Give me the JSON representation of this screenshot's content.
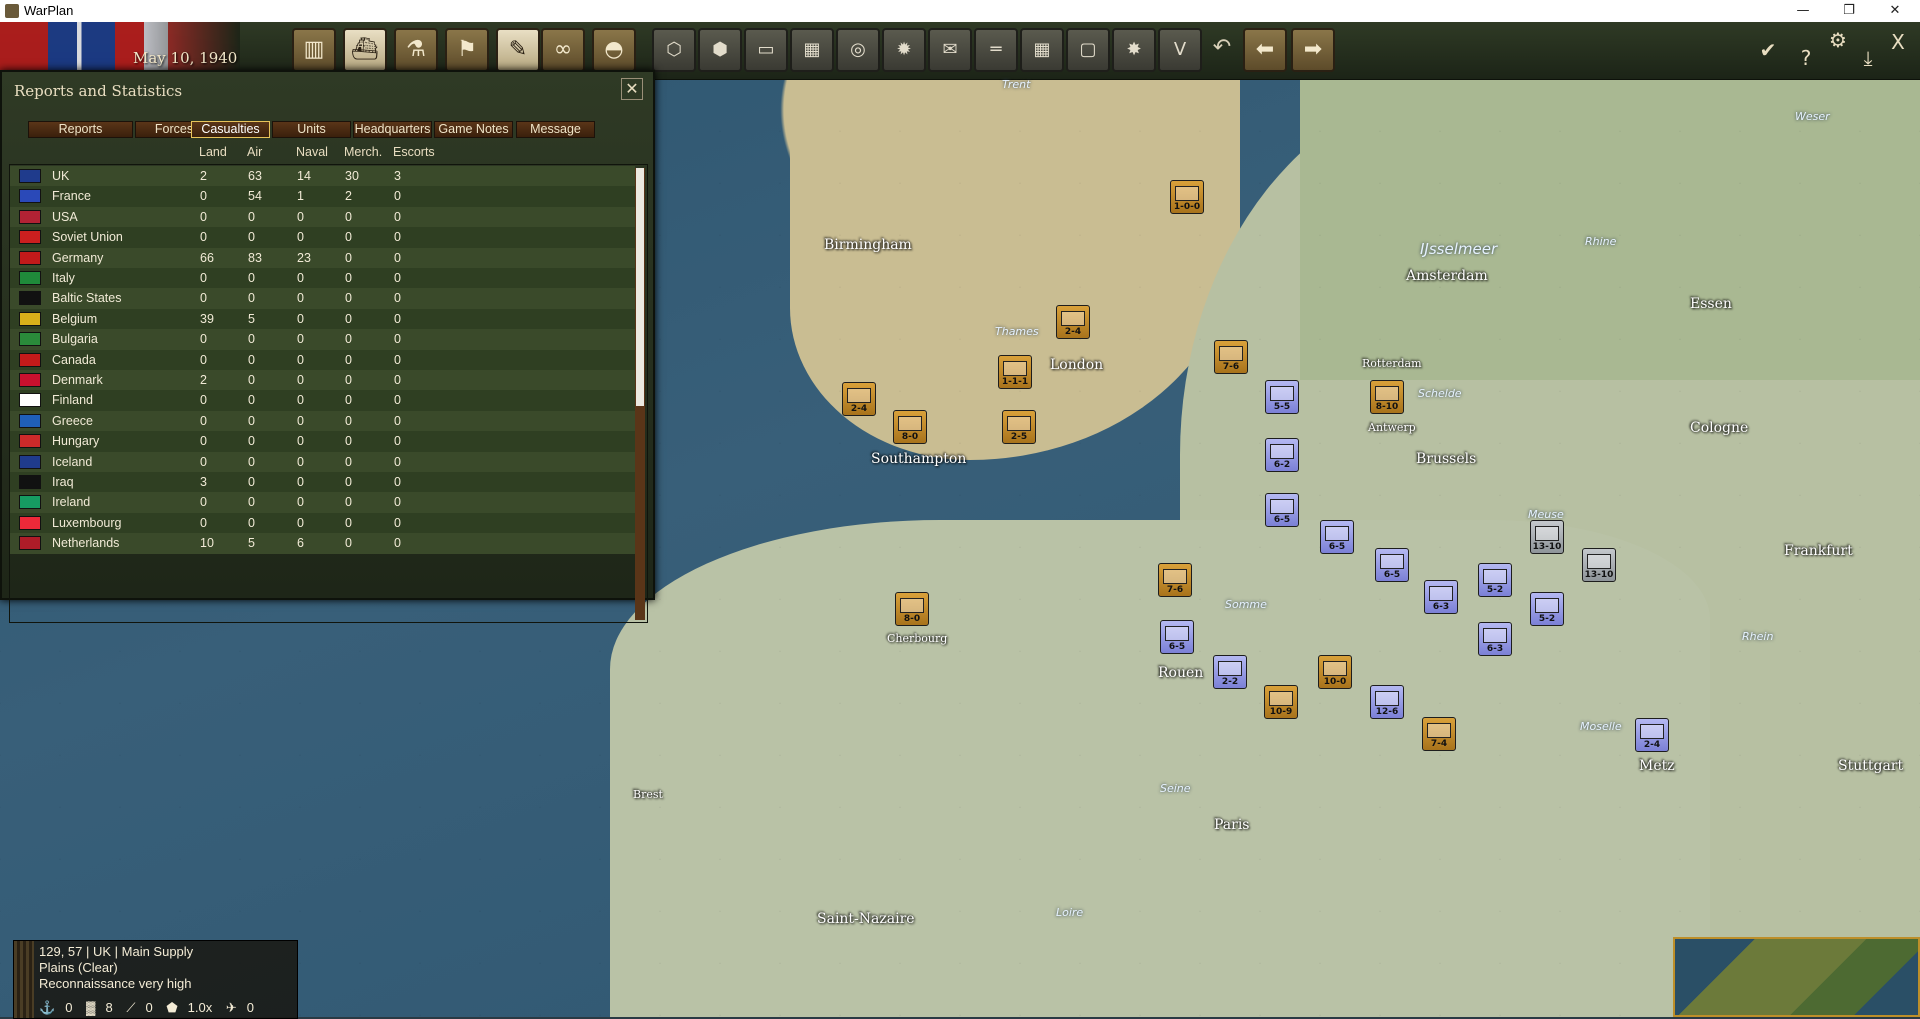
{
  "window": {
    "title": "WarPlan",
    "minimize": "—",
    "maximize": "❐",
    "close": "✕"
  },
  "header": {
    "date": "May 10, 1940"
  },
  "toolbar": {
    "left_icons": [
      "factory-icon",
      "ship-icon",
      "microscope-icon",
      "flag-icon",
      "report-icon",
      "binoculars-icon",
      "helmet-icon"
    ],
    "right_symbols": {
      "confirm": "✔",
      "help": "?",
      "settings": "⚙",
      "save": "⤓",
      "exit": "X"
    },
    "v_label": "V"
  },
  "panel": {
    "title": "Reports and Statistics",
    "close": "✕",
    "tabs": [
      "Reports",
      "Forces",
      "Casualties",
      "Units",
      "Headquarters",
      "Game Notes",
      "Message"
    ],
    "active_tab": "Casualties",
    "columns": [
      "Land",
      "Air",
      "Naval",
      "Merch.",
      "Escorts"
    ],
    "rows": [
      {
        "country": "UK",
        "land": "2",
        "air": "63",
        "naval": "14",
        "merch": "30",
        "escorts": "3"
      },
      {
        "country": "France",
        "land": "0",
        "air": "54",
        "naval": "1",
        "merch": "2",
        "escorts": "0"
      },
      {
        "country": "USA",
        "land": "0",
        "air": "0",
        "naval": "0",
        "merch": "0",
        "escorts": "0"
      },
      {
        "country": "Soviet Union",
        "land": "0",
        "air": "0",
        "naval": "0",
        "merch": "0",
        "escorts": "0"
      },
      {
        "country": "Germany",
        "land": "66",
        "air": "83",
        "naval": "23",
        "merch": "0",
        "escorts": "0"
      },
      {
        "country": "Italy",
        "land": "0",
        "air": "0",
        "naval": "0",
        "merch": "0",
        "escorts": "0"
      },
      {
        "country": "Baltic States",
        "land": "0",
        "air": "0",
        "naval": "0",
        "merch": "0",
        "escorts": "0"
      },
      {
        "country": "Belgium",
        "land": "39",
        "air": "5",
        "naval": "0",
        "merch": "0",
        "escorts": "0"
      },
      {
        "country": "Bulgaria",
        "land": "0",
        "air": "0",
        "naval": "0",
        "merch": "0",
        "escorts": "0"
      },
      {
        "country": "Canada",
        "land": "0",
        "air": "0",
        "naval": "0",
        "merch": "0",
        "escorts": "0"
      },
      {
        "country": "Denmark",
        "land": "2",
        "air": "0",
        "naval": "0",
        "merch": "0",
        "escorts": "0"
      },
      {
        "country": "Finland",
        "land": "0",
        "air": "0",
        "naval": "0",
        "merch": "0",
        "escorts": "0"
      },
      {
        "country": "Greece",
        "land": "0",
        "air": "0",
        "naval": "0",
        "merch": "0",
        "escorts": "0"
      },
      {
        "country": "Hungary",
        "land": "0",
        "air": "0",
        "naval": "0",
        "merch": "0",
        "escorts": "0"
      },
      {
        "country": "Iceland",
        "land": "0",
        "air": "0",
        "naval": "0",
        "merch": "0",
        "escorts": "0"
      },
      {
        "country": "Iraq",
        "land": "3",
        "air": "0",
        "naval": "0",
        "merch": "0",
        "escorts": "0"
      },
      {
        "country": "Ireland",
        "land": "0",
        "air": "0",
        "naval": "0",
        "merch": "0",
        "escorts": "0"
      },
      {
        "country": "Luxembourg",
        "land": "0",
        "air": "0",
        "naval": "0",
        "merch": "0",
        "escorts": "0"
      },
      {
        "country": "Netherlands",
        "land": "10",
        "air": "5",
        "naval": "6",
        "merch": "0",
        "escorts": "0"
      }
    ],
    "flag_colors": [
      "#1f3b8c",
      "#2a49b8",
      "#b22234",
      "#cc1f1f",
      "#c21a1a",
      "#1f8a3a",
      "#111111",
      "#d8b01a",
      "#2a8a3a",
      "#c21a1a",
      "#c8102e",
      "#ffffff",
      "#1f5fb8",
      "#cc2a2a",
      "#1f3b8c",
      "#111111",
      "#169b62",
      "#ed2939",
      "#ae1c28"
    ]
  },
  "map": {
    "cities": [
      "Birmingham",
      "London",
      "Southampton",
      "Amsterdam",
      "Rotterdam",
      "Antwerp",
      "Brussels",
      "Essen",
      "Cologne",
      "Frankfurt",
      "Cherbourg",
      "Rouen",
      "Paris",
      "Brest",
      "Saint-Nazaire",
      "Metz",
      "Stuttgart"
    ],
    "rivers": [
      "Trent",
      "Thames",
      "Somme",
      "Seine",
      "Loire",
      "Meuse",
      "Moselle",
      "Rhein",
      "Rhine",
      "Weser",
      "Schelde",
      "IJsselmeer"
    ],
    "units": [
      {
        "label": "2-4",
        "side": "uk"
      },
      {
        "label": "8-0",
        "side": "uk"
      },
      {
        "label": "1-1-1",
        "side": "uk"
      },
      {
        "label": "2-5",
        "side": "uk"
      },
      {
        "label": "1-0-0",
        "side": "uk"
      },
      {
        "label": "2-4",
        "side": "uk"
      },
      {
        "label": "7-6",
        "side": "uk"
      },
      {
        "label": "8-0",
        "side": "uk"
      },
      {
        "label": "7-6",
        "side": "uk"
      },
      {
        "label": "10-0",
        "side": "uk"
      },
      {
        "label": "10-9",
        "side": "uk"
      },
      {
        "label": "7-4",
        "side": "uk"
      },
      {
        "label": "5-5",
        "side": "fr"
      },
      {
        "label": "6-2",
        "side": "fr"
      },
      {
        "label": "6-5",
        "side": "fr"
      },
      {
        "label": "6-5",
        "side": "fr"
      },
      {
        "label": "6-5",
        "side": "fr"
      },
      {
        "label": "6-3",
        "side": "fr"
      },
      {
        "label": "6-3",
        "side": "fr"
      },
      {
        "label": "5-2",
        "side": "fr"
      },
      {
        "label": "5-2",
        "side": "fr"
      },
      {
        "label": "2-2",
        "side": "fr"
      },
      {
        "label": "6-5",
        "side": "fr"
      },
      {
        "label": "12-6",
        "side": "fr"
      },
      {
        "label": "2-4",
        "side": "fr"
      },
      {
        "label": "13-10",
        "side": "de"
      },
      {
        "label": "13-10",
        "side": "de"
      },
      {
        "label": "8-10",
        "side": "be"
      }
    ]
  },
  "status": {
    "line1": "129, 57 | UK | Main Supply",
    "line2": "Plains (Clear)",
    "line3": "Reconnaissance very high",
    "stats": [
      "0",
      "8",
      "0",
      "1.0x",
      "0"
    ]
  }
}
